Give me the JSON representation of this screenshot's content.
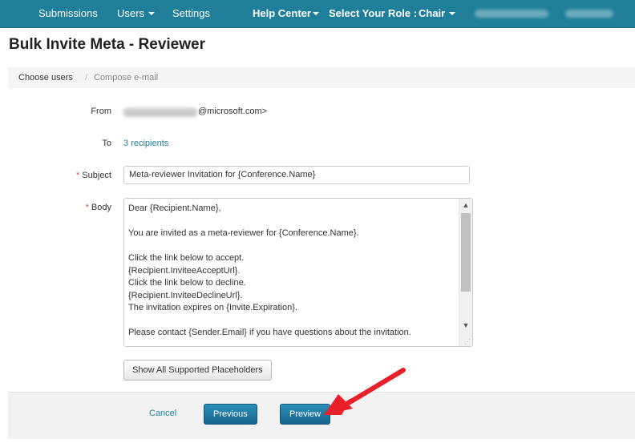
{
  "nav": {
    "items": [
      {
        "label": "Submissions"
      },
      {
        "label": "Users"
      },
      {
        "label": "Settings"
      },
      {
        "label": "Help Center"
      },
      {
        "label": "Select Your Role :"
      },
      {
        "label": "Chair"
      }
    ]
  },
  "page": {
    "title": "Bulk Invite Meta - Reviewer"
  },
  "breadcrumb": {
    "active": "Choose users",
    "separator": "/",
    "inactive": "Compose e-mail"
  },
  "form": {
    "from_label": "From",
    "from_value": "@microsoft.com>",
    "to_label": "To",
    "to_value": "3 recipients",
    "subject_label": "Subject",
    "subject_value": "Meta-reviewer Invitation for {Conference.Name}",
    "body_label": "Body",
    "required_marker": "*",
    "body_value": "Dear {Recipient.Name},\n\nYou are invited as a meta-reviewer for {Conference.Name}.\n\nClick the link below to accept.\n{Recipient.InviteeAcceptUrl}.\nClick the link below to decline.\n{Recipient.InviteeDeclineUrl}.\nThe invitation expires on {Invite.Expiration}.\n\nPlease contact {Sender.Email} if you have questions about the invitation.",
    "placeholders_button": "Show All Supported Placeholders"
  },
  "actions": {
    "cancel": "Cancel",
    "previous": "Previous",
    "preview": "Preview"
  },
  "colors": {
    "navbar": "#1f7f9a",
    "link": "#1f7f9a",
    "primary_button": "#17648c",
    "required": "#d9534f",
    "annotation_arrow": "#e8202a"
  },
  "icons": {
    "dropdown": "caret-down-icon",
    "scroll_up": "scroll-up-icon",
    "scroll_down": "scroll-down-icon",
    "resize": "resize-grip-icon"
  }
}
